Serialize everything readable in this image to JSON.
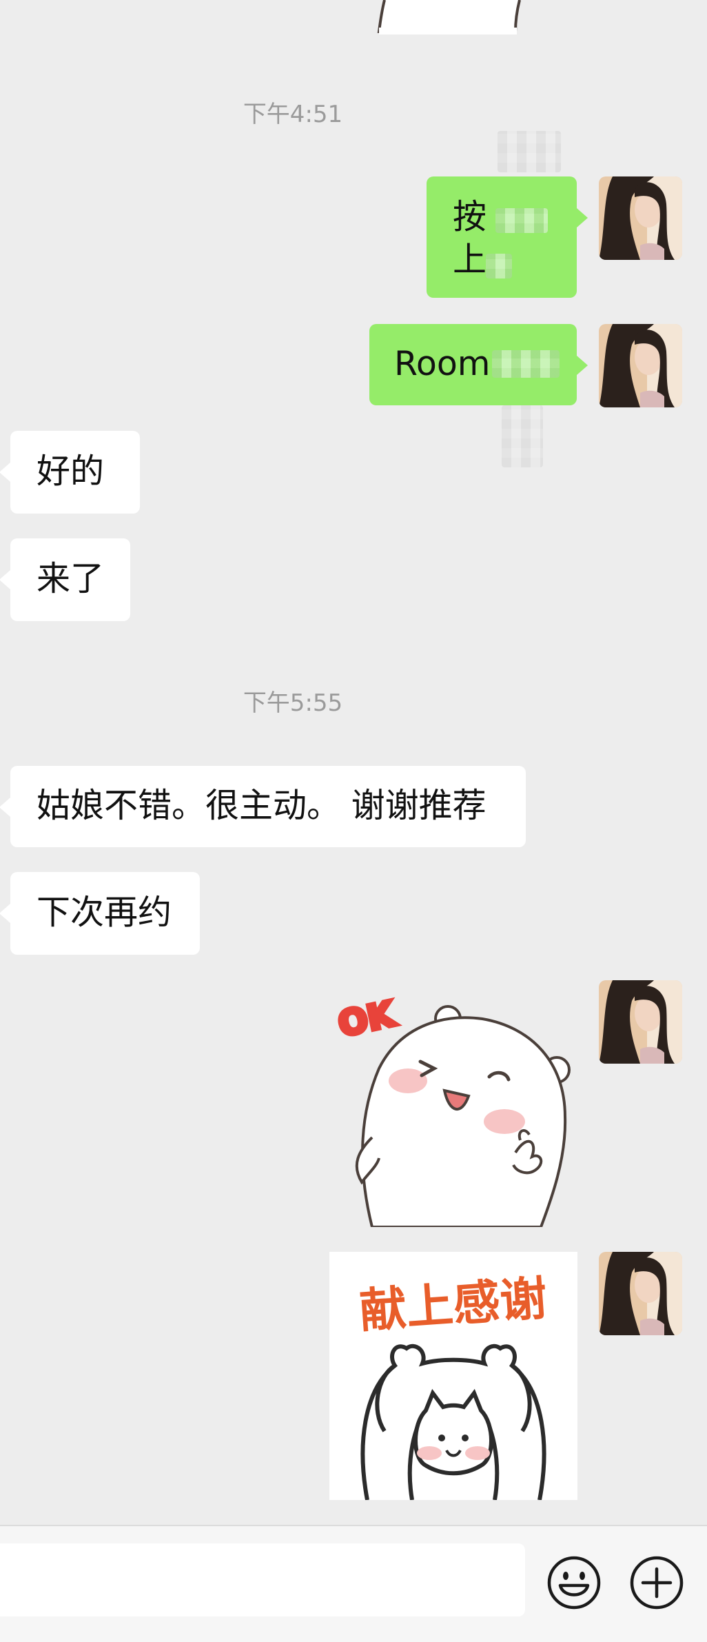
{
  "chat": {
    "messages": [
      {
        "type": "timestamp",
        "text": "下午4:51"
      },
      {
        "type": "outgoing",
        "lines": [
          "按",
          "上"
        ],
        "redacted": true
      },
      {
        "type": "outgoing",
        "text": "Room",
        "redacted": true
      },
      {
        "type": "incoming",
        "text": "好的"
      },
      {
        "type": "incoming",
        "text": "来了"
      },
      {
        "type": "timestamp",
        "text": "下午5:55"
      },
      {
        "type": "incoming",
        "text": "姑娘不错。很主动。 谢谢推荐"
      },
      {
        "type": "incoming",
        "text": "下次再约"
      },
      {
        "type": "outgoing-sticker",
        "sticker_text": "OK",
        "icon": "bear-ok-sticker"
      },
      {
        "type": "outgoing-sticker",
        "sticker_text": "献上感谢",
        "icon": "cat-thanks-sticker"
      }
    ]
  },
  "composer": {
    "input_value": "",
    "emoji_icon": "emoji-smile-icon",
    "plus_icon": "plus-circle-icon"
  },
  "colors": {
    "background": "#ededed",
    "outgoing_bubble": "#95ec69",
    "incoming_bubble": "#ffffff",
    "timestamp_text": "#9a9a9a",
    "sticker_accent": "#e8433a"
  }
}
